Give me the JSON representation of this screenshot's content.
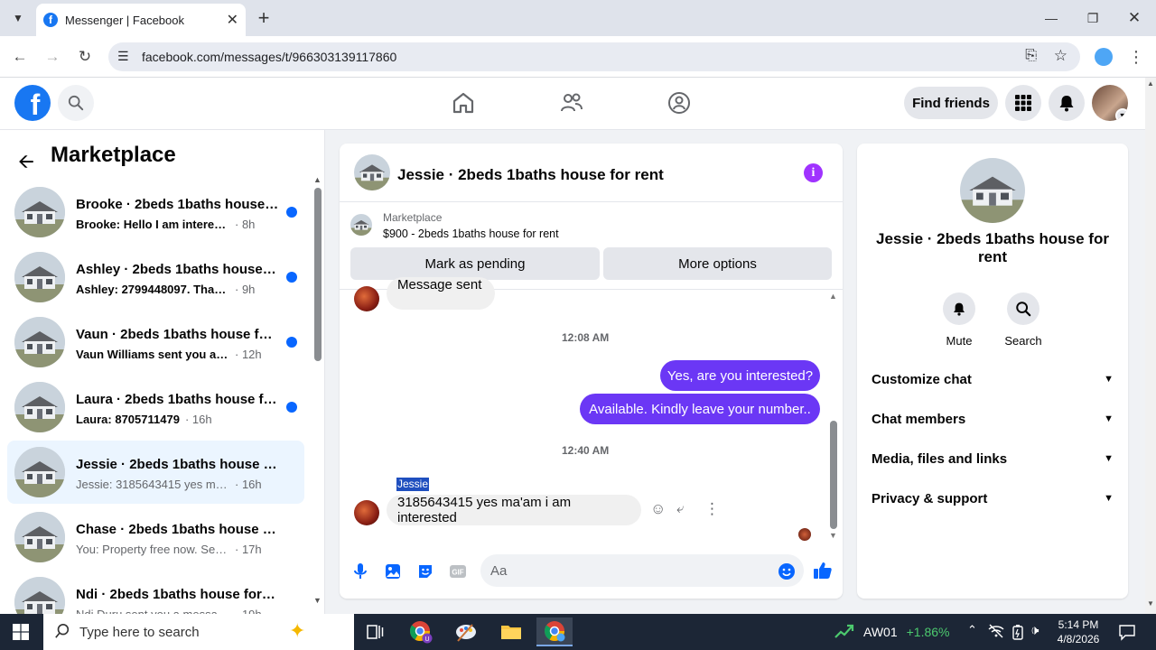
{
  "browser": {
    "tab_title": "Messenger | Facebook",
    "url": "facebook.com/messages/t/966303139117860"
  },
  "fb_header": {
    "find_friends": "Find friends"
  },
  "marketplace": {
    "title": "Marketplace",
    "conversations": [
      {
        "title": "Brooke · 2beds 1baths house f...",
        "preview": "Brooke: Hello I am interested",
        "time": "· 8h",
        "unread": true
      },
      {
        "title": "Ashley · 2beds 1baths house fo...",
        "preview": "Ashley: 2799448097. Thanks!",
        "time": "· 9h",
        "unread": true
      },
      {
        "title": "Vaun · 2beds 1baths house for ...",
        "preview": "Vaun Williams sent you a mess...",
        "time": "· 12h",
        "unread": true
      },
      {
        "title": "Laura · 2beds 1baths house for...",
        "preview": "Laura: 8705711479",
        "time": "· 16h",
        "unread": true
      },
      {
        "title": "Jessie · 2beds 1baths house for r...",
        "preview": "Jessie: 3185643415 yes ma'am i a...",
        "time": "· 16h",
        "unread": false
      },
      {
        "title": "Chase · 2beds 1baths house for r...",
        "preview": "You: Property free now. Send cont...",
        "time": "· 17h",
        "unread": false
      },
      {
        "title": "Ndi · 2beds 1baths house for rent",
        "preview": "Ndi Duru sent you a message abo...",
        "time": "· 19h",
        "unread": false
      }
    ]
  },
  "chat": {
    "title": "Jessie · 2beds 1baths house for rent",
    "marketplace_label": "Marketplace",
    "listing": "$900 - 2beds 1baths house for rent",
    "mark_pending": "Mark as pending",
    "more_options": "More options",
    "cut_message": "Message sent",
    "time1": "12:08 AM",
    "out1": "Yes, are you interested?",
    "out2": "Available. Kindly leave your number..",
    "time2": "12:40 AM",
    "sender_name": "Jessie",
    "in1": "3185643415 yes ma'am i am interested",
    "input_placeholder": "Aa"
  },
  "details": {
    "name": "Jessie · 2beds 1baths house for rent",
    "mute": "Mute",
    "search": "Search",
    "rows": [
      "Customize chat",
      "Chat members",
      "Media, files and links",
      "Privacy & support"
    ]
  },
  "taskbar": {
    "search_placeholder": "Type here to search",
    "stock_name": "AW01",
    "stock_change": "+1.86%",
    "time": "5:14 PM",
    "date": "4/8/2026"
  },
  "colors": {
    "fb_blue": "#1877f2",
    "messenger_purple": "#6b37f5",
    "unread_dot": "#0866ff",
    "stock_green": "#4cc96e"
  }
}
